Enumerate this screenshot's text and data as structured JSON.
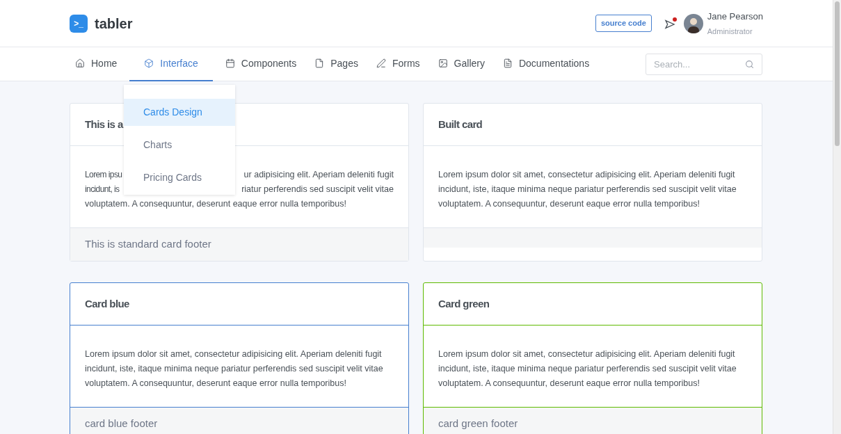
{
  "brand": {
    "name": "tabler",
    "logo_glyph": ">_"
  },
  "header": {
    "source_button": "source code",
    "notification": {
      "unread": true
    },
    "user": {
      "name": "Jane Pearson",
      "role": "Administrator"
    }
  },
  "nav": {
    "items": [
      {
        "label": "Home",
        "selected": false
      },
      {
        "label": "Interface",
        "selected": true
      },
      {
        "label": "Components",
        "selected": false
      },
      {
        "label": "Pages",
        "selected": false
      },
      {
        "label": "Forms",
        "selected": false
      },
      {
        "label": "Gallery",
        "selected": false
      },
      {
        "label": "Documentations",
        "selected": false
      }
    ],
    "search": {
      "placeholder": "Search..."
    }
  },
  "dropdown": {
    "items": [
      {
        "label": "Cards Design",
        "selected": true
      },
      {
        "label": "Charts",
        "selected": false
      },
      {
        "label": "Pricing Cards",
        "selected": false
      }
    ]
  },
  "cards": [
    {
      "title": "This is a",
      "body_lines": [
        [
          "Lorem ipsu",
          "ur adipisicing elit. Aperiam deleniti fugit"
        ],
        [
          "incidunt, is",
          "riatur perferendis sed suscipit velit vitae"
        ],
        [
          "voluptatem. A consequuntur, deserunt eaque error nulla temporibus!"
        ]
      ],
      "footer": "This is standard card footer"
    },
    {
      "title": "Built card",
      "body": "Lorem ipsum dolor sit amet, consectetur adipisicing elit. Aperiam deleniti fugit incidunt, iste, itaque minima neque pariatur perferendis sed suscipit velit vitae voluptatem. A consequuntur, deserunt eaque error nulla temporibus!"
    },
    {
      "title": "Card blue",
      "color": "#467fcf",
      "body": "Lorem ipsum dolor sit amet, consectetur adipisicing elit. Aperiam deleniti fugit incidunt, iste, itaque minima neque pariatur perferendis sed suscipit velit vitae voluptatem. A consequuntur, deserunt eaque error nulla temporibus!",
      "footer": "card blue footer"
    },
    {
      "title": "Card green",
      "color": "#5eba00",
      "body": "Lorem ipsum dolor sit amet, consectetur adipisicing elit. Aperiam deleniti fugit incidunt, iste, itaque minima neque pariatur perferendis sed suscipit velit vitae voluptatem. A consequuntur, deserunt eaque error nulla temporibus!",
      "footer": "card green footer"
    }
  ]
}
